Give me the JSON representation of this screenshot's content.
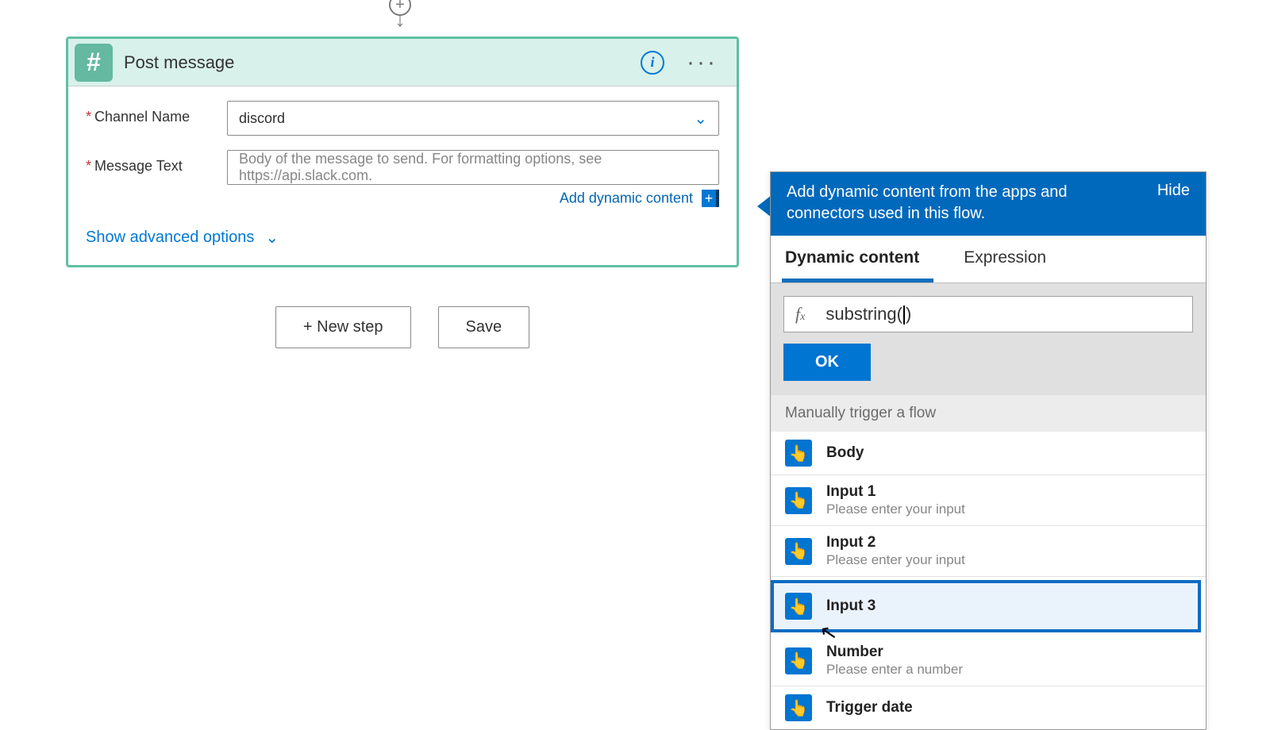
{
  "card": {
    "title": "Post message",
    "fields": {
      "channel": {
        "label": "Channel Name",
        "value": "discord"
      },
      "message": {
        "label": "Message Text",
        "placeholder": "Body of the message to send. For formatting options, see https://api.slack.com."
      }
    },
    "add_dynamic": "Add dynamic content",
    "advanced": "Show advanced options"
  },
  "actions": {
    "new_step": "+ New step",
    "save": "Save"
  },
  "dyn": {
    "header": "Add dynamic content from the apps and connectors used in this flow.",
    "hide": "Hide",
    "tabs": {
      "dynamic": "Dynamic content",
      "expression": "Expression"
    },
    "expr": {
      "text_left": "substring(",
      "text_right": ")"
    },
    "ok": "OK",
    "section": "Manually trigger a flow",
    "items": [
      {
        "title": "Body",
        "sub": ""
      },
      {
        "title": "Input 1",
        "sub": "Please enter your input"
      },
      {
        "title": "Input 2",
        "sub": "Please enter your input"
      },
      {
        "title": "Input 3",
        "sub": ""
      },
      {
        "title": "Number",
        "sub": "Please enter a number"
      },
      {
        "title": "Trigger date",
        "sub": ""
      }
    ]
  }
}
